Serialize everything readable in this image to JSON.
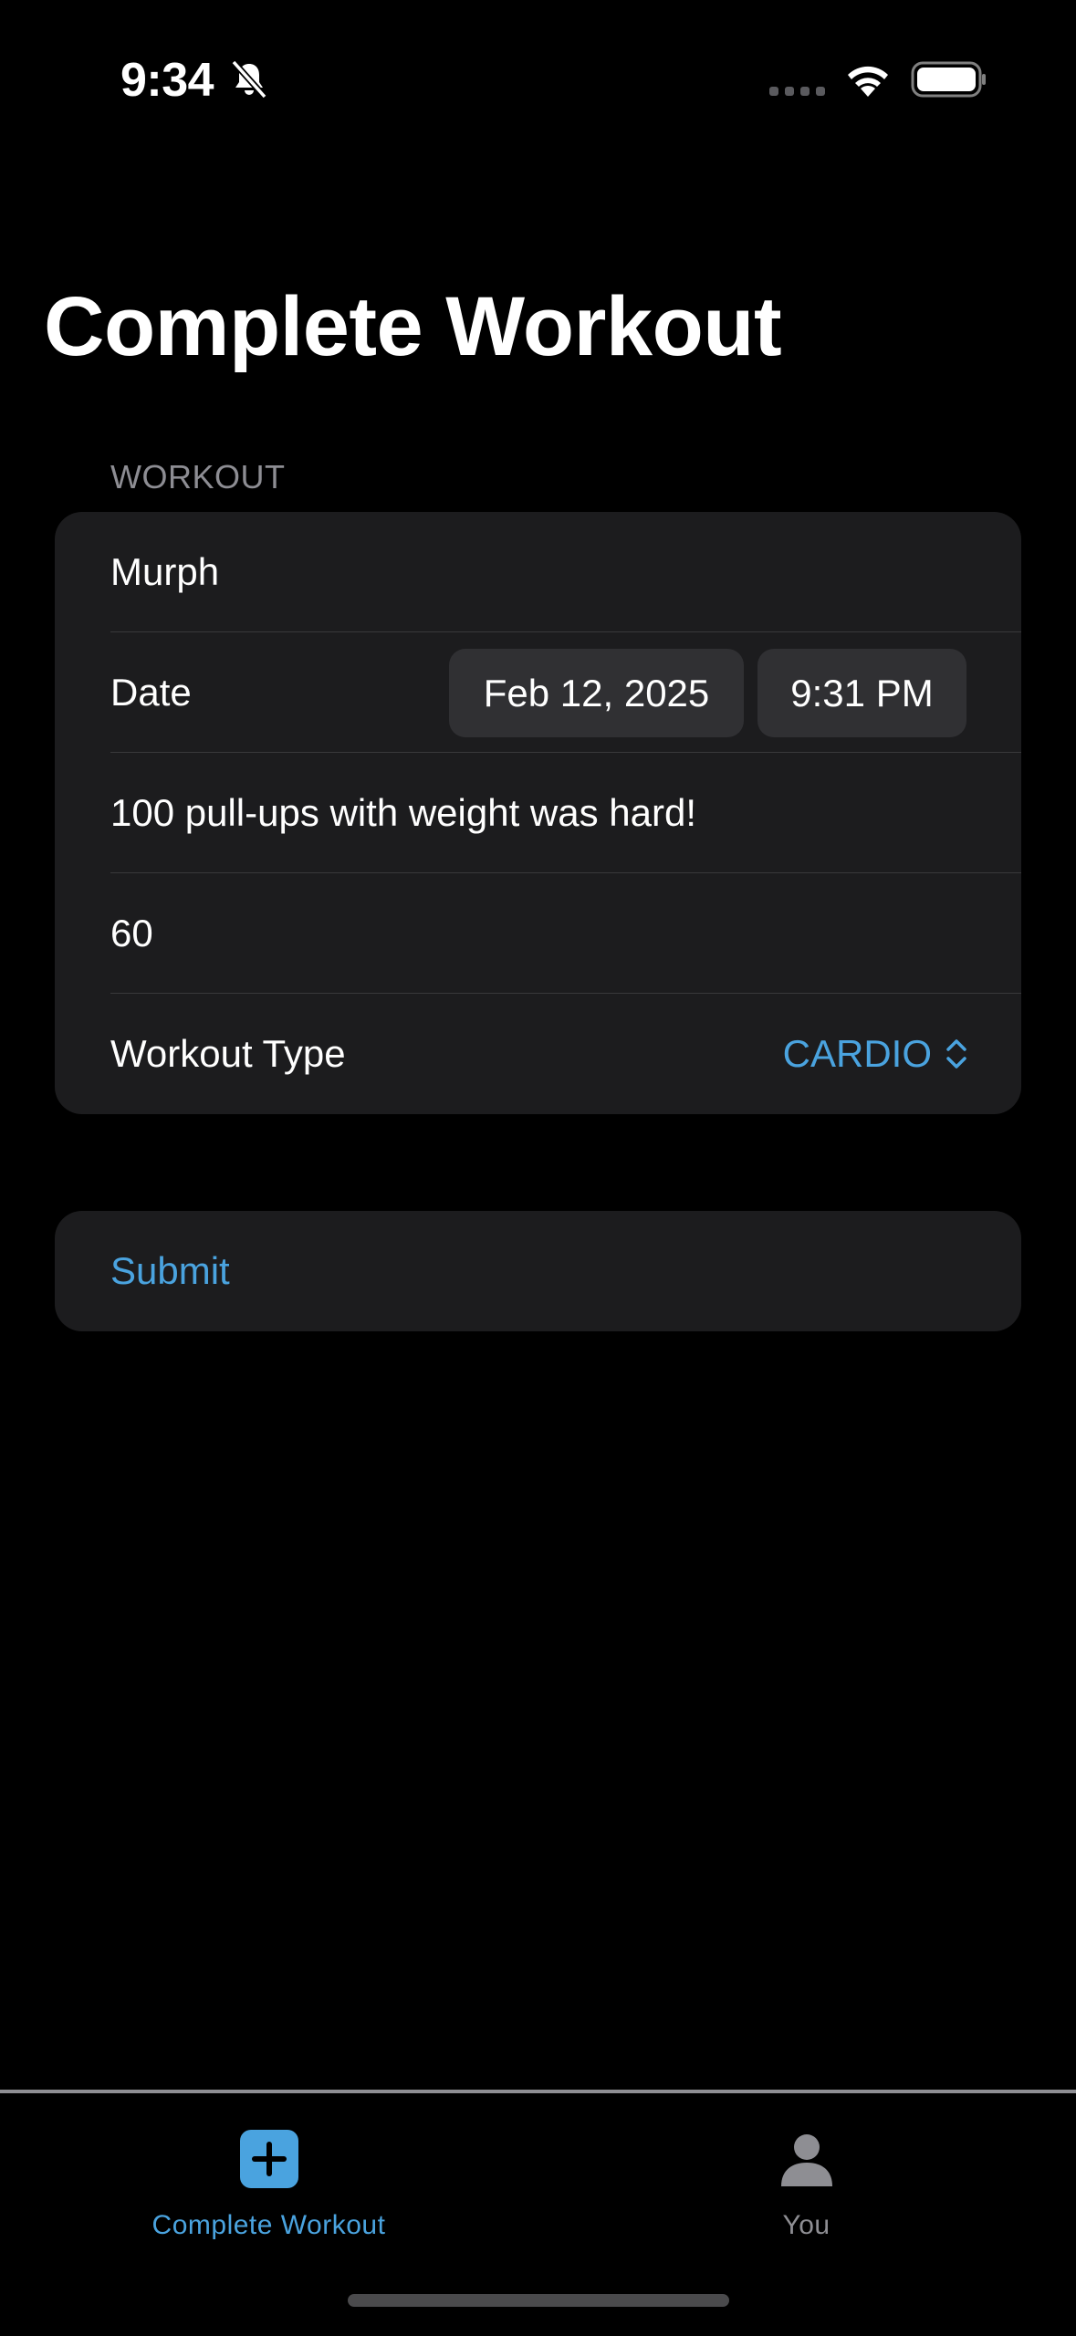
{
  "status_bar": {
    "time": "9:34",
    "icons": [
      "bell-slash-icon",
      "signal-icon",
      "wifi-icon",
      "battery-icon"
    ]
  },
  "title": "Complete Workout",
  "section": {
    "header": "WORKOUT"
  },
  "form": {
    "name_value": "Murph",
    "date_label": "Date",
    "date_value": "Feb 12, 2025",
    "time_value": "9:31 PM",
    "notes_value": "100 pull-ups with weight was hard!",
    "duration_value": "60",
    "type_label": "Workout Type",
    "type_value": "CARDIO"
  },
  "submit": {
    "label": "Submit"
  },
  "tab_bar": {
    "tabs": [
      {
        "label": "Complete Workout",
        "icon": "plus-square-icon",
        "selected": true
      },
      {
        "label": "You",
        "icon": "person-icon",
        "selected": false
      }
    ]
  },
  "colors": {
    "background": "#000000",
    "card": "#1c1c1e",
    "accent": "#4aa3df",
    "secondary_text": "#8d8d93",
    "chip": "#303033"
  }
}
